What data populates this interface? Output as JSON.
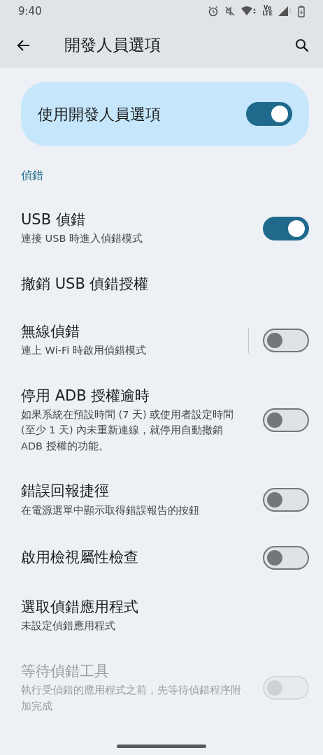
{
  "status_bar": {
    "time": "9:40",
    "volte_top": "Vo",
    "volte_bottom": "LTE"
  },
  "app_bar": {
    "title": "開發人員選項"
  },
  "main_switch": {
    "label": "使用開發人員選項",
    "on": true
  },
  "section": {
    "title": "偵錯"
  },
  "items": [
    {
      "kind": "switch",
      "title": "USB 偵錯",
      "subtitle": "連接 USB 時進入偵錯模式",
      "on": true,
      "disabled": false,
      "divider": false
    },
    {
      "kind": "plain",
      "title": "撤銷 USB 偵錯授權",
      "disabled": false
    },
    {
      "kind": "switch",
      "title": "無線偵錯",
      "subtitle": "連上 Wi-Fi 時啟用偵錯模式",
      "on": false,
      "disabled": false,
      "divider": true
    },
    {
      "kind": "switch",
      "title": "停用 ADB 授權逾時",
      "subtitle": "如果系統在預設時間 (7 天) 或使用者設定時間 (至少 1 天) 內未重新連線，就停用自動撤銷 ADB 授權的功能。",
      "on": false,
      "disabled": false,
      "divider": false
    },
    {
      "kind": "switch",
      "title": "錯誤回報捷徑",
      "subtitle": "在電源選單中顯示取得錯誤報告的按鈕",
      "on": false,
      "disabled": false,
      "divider": false
    },
    {
      "kind": "switch",
      "title": "啟用檢視屬性檢查",
      "on": false,
      "disabled": false,
      "divider": false
    },
    {
      "kind": "plain",
      "title": "選取偵錯應用程式",
      "subtitle": "未設定偵錯應用程式",
      "disabled": false
    },
    {
      "kind": "switch",
      "title": "等待偵錯工具",
      "subtitle": "執行受偵錯的應用程式之前，先等待偵錯程序附加完成",
      "on": false,
      "disabled": true,
      "divider": false
    }
  ]
}
